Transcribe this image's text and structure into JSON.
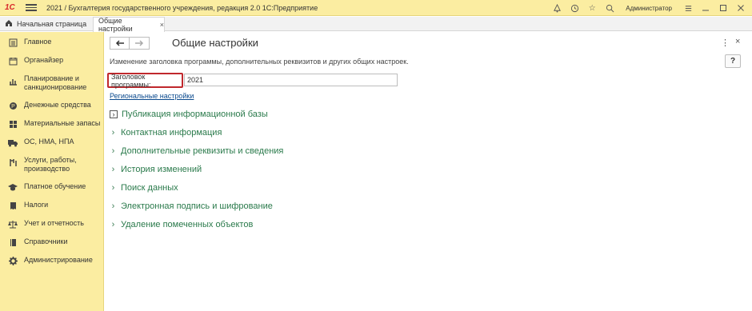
{
  "titlebar": {
    "logo": "1С",
    "title": "2021 / Бухгалтерия государственного учреждения, редакция 2.0 1С:Предприятие",
    "user": "Администратор",
    "icons": [
      "bell-icon",
      "history-icon",
      "star-icon",
      "search-icon",
      "settings-menu-icon",
      "minimize-icon",
      "restore-icon",
      "close-icon"
    ]
  },
  "tabs": {
    "home_label": "Начальная страница",
    "active_label": "Общие настройки",
    "close_glyph": "×"
  },
  "sidebar": {
    "items": [
      {
        "label": "Главное",
        "icon": "list-icon"
      },
      {
        "label": "Органайзер",
        "icon": "organizer-icon"
      },
      {
        "label": "Планирование и санкционирование",
        "icon": "planning-icon"
      },
      {
        "label": "Денежные средства",
        "icon": "money-icon"
      },
      {
        "label": "Материальные запасы",
        "icon": "inventory-icon"
      },
      {
        "label": "ОС, НМА, НПА",
        "icon": "truck-icon"
      },
      {
        "label": "Услуги, работы, производство",
        "icon": "services-icon"
      },
      {
        "label": "Платное обучение",
        "icon": "graduation-icon"
      },
      {
        "label": "Налоги",
        "icon": "taxes-icon"
      },
      {
        "label": "Учет и отчетность",
        "icon": "scales-icon"
      },
      {
        "label": "Справочники",
        "icon": "book-icon"
      },
      {
        "label": "Администрирование",
        "icon": "gear-icon"
      }
    ]
  },
  "main": {
    "title": "Общие настройки",
    "description": "Изменение заголовка программы, дополнительных реквизитов и других общих настроек.",
    "field_label": "Заголовок программы:",
    "field_value": "2021",
    "regional_link": "Региональные настройки",
    "help_label": "?",
    "more_glyph": "⋮",
    "close_glyph": "×",
    "groups": [
      "Публикация информационной базы",
      "Контактная информация",
      "Дополнительные реквизиты и сведения",
      "История изменений",
      "Поиск данных",
      "Электронная подпись и шифрование",
      "Удаление помеченных объектов"
    ]
  },
  "colors": {
    "panel": "#fbeda1",
    "group_text": "#2a7a4b",
    "highlight": "#c0282d",
    "link": "#0b4a8e"
  }
}
